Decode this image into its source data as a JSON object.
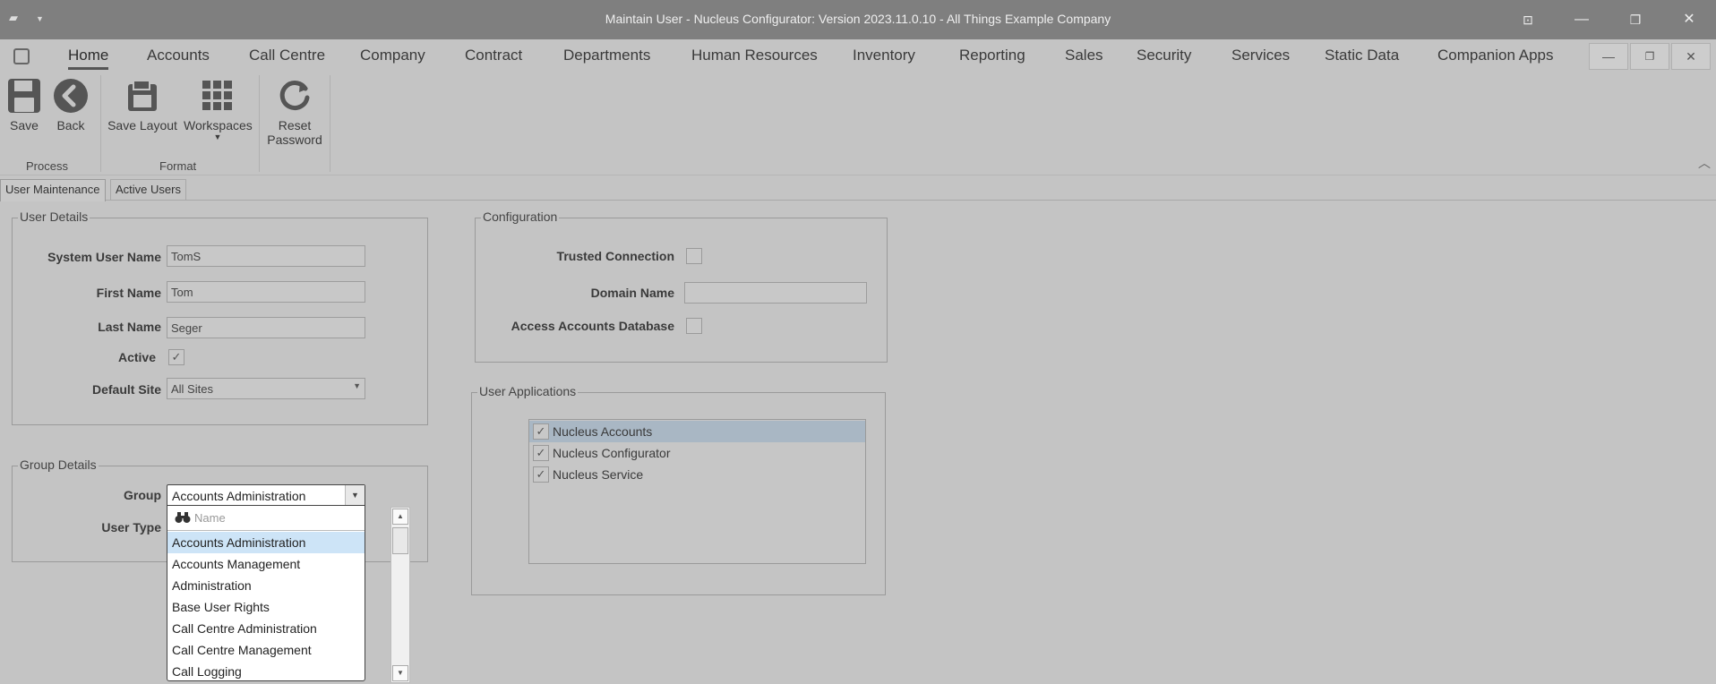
{
  "window": {
    "title": "Maintain User - Nucleus Configurator: Version 2023.11.0.10 - All Things Example Company"
  },
  "menu": {
    "items": [
      "Home",
      "Accounts",
      "Call Centre",
      "Company",
      "Contract",
      "Departments",
      "Human Resources",
      "Inventory",
      "Reporting",
      "Sales",
      "Security",
      "Services",
      "Static Data",
      "Companion Apps"
    ],
    "active": "Home"
  },
  "ribbon": {
    "save": "Save",
    "back": "Back",
    "save_layout": "Save Layout",
    "workspaces": "Workspaces",
    "reset_password_line1": "Reset",
    "reset_password_line2": "Password",
    "group_process": "Process",
    "group_format": "Format"
  },
  "tabs": {
    "user_maintenance": "User Maintenance",
    "active_users": "Active Users"
  },
  "user_details": {
    "legend": "User Details",
    "system_user_name_label": "System User Name",
    "system_user_name": "TomS",
    "first_name_label": "First Name",
    "first_name": "Tom",
    "last_name_label": "Last Name",
    "last_name": "Seger",
    "active_label": "Active",
    "active": true,
    "default_site_label": "Default Site",
    "default_site": "All Sites"
  },
  "group_details": {
    "legend": "Group Details",
    "group_label": "Group",
    "group": "Accounts Administration",
    "user_type_label": "User Type",
    "search_placeholder": "Name",
    "options": [
      "Accounts Administration",
      "Accounts Management",
      "Administration",
      "Base User Rights",
      "Call Centre Administration",
      "Call Centre Management",
      "Call Logging"
    ],
    "selected_index": 0
  },
  "configuration": {
    "legend": "Configuration",
    "trusted_connection_label": "Trusted Connection",
    "trusted_connection": false,
    "domain_name_label": "Domain Name",
    "domain_name": "",
    "access_accounts_db_label": "Access Accounts Database",
    "access_accounts_db": false
  },
  "user_applications": {
    "legend": "User Applications",
    "items": [
      {
        "label": "Nucleus Accounts",
        "checked": true
      },
      {
        "label": "Nucleus Configurator",
        "checked": true
      },
      {
        "label": "Nucleus Service",
        "checked": true
      }
    ]
  },
  "icons": {
    "check": "✓",
    "dropdown": "▼",
    "minimize": "—",
    "restore": "❐",
    "close": "✕"
  }
}
